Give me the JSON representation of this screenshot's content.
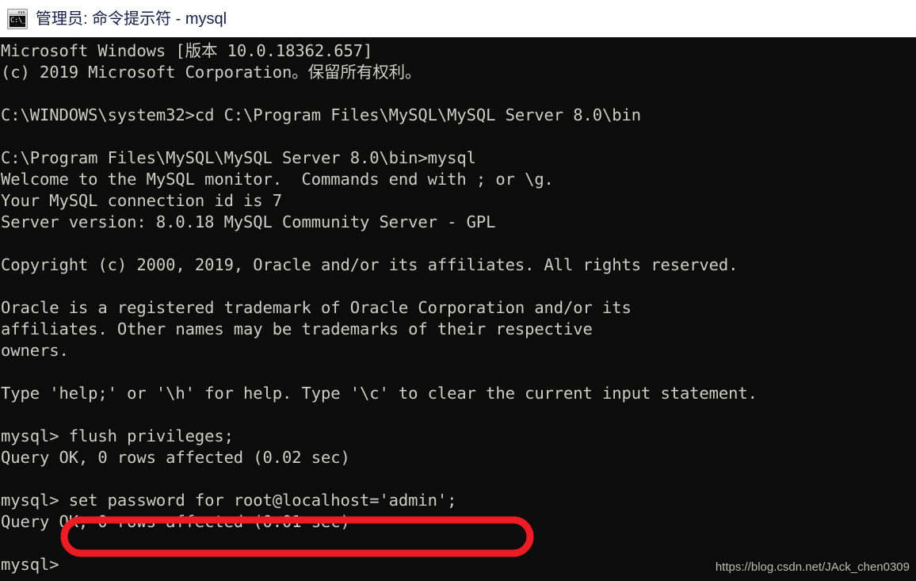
{
  "window": {
    "title": "管理员: 命令提示符 - mysql",
    "icon": "cmd-icon",
    "icon_glyph": "C:\\_",
    "background_color": "#0c0c0c",
    "text_color": "#ccccc8",
    "titlebar_color": "#ffffff"
  },
  "console": {
    "text": "Microsoft Windows [版本 10.0.18362.657]\n(c) 2019 Microsoft Corporation。保留所有权利。\n\nC:\\WINDOWS\\system32>cd C:\\Program Files\\MySQL\\MySQL Server 8.0\\bin\n\nC:\\Program Files\\MySQL\\MySQL Server 8.0\\bin>mysql\nWelcome to the MySQL monitor.  Commands end with ; or \\g.\nYour MySQL connection id is 7\nServer version: 8.0.18 MySQL Community Server - GPL\n\nCopyright (c) 2000, 2019, Oracle and/or its affiliates. All rights reserved.\n\nOracle is a registered trademark of Oracle Corporation and/or its\naffiliates. Other names may be trademarks of their respective\nowners.\n\nType 'help;' or '\\h' for help. Type '\\c' to clear the current input statement.\n\nmysql> flush privileges;\nQuery OK, 0 rows affected (0.02 sec)\n\nmysql> set password for root@localhost='admin';\nQuery OK, 0 rows affected (0.01 sec)\n\nmysql>",
    "lines": [
      "Microsoft Windows [版本 10.0.18362.657]",
      "(c) 2019 Microsoft Corporation。保留所有权利。",
      "",
      "C:\\WINDOWS\\system32>cd C:\\Program Files\\MySQL\\MySQL Server 8.0\\bin",
      "",
      "C:\\Program Files\\MySQL\\MySQL Server 8.0\\bin>mysql",
      "Welcome to the MySQL monitor.  Commands end with ; or \\g.",
      "Your MySQL connection id is 7",
      "Server version: 8.0.18 MySQL Community Server - GPL",
      "",
      "Copyright (c) 2000, 2019, Oracle and/or its affiliates. All rights reserved.",
      "",
      "Oracle is a registered trademark of Oracle Corporation and/or its",
      "affiliates. Other names may be trademarks of their respective",
      "owners.",
      "",
      "Type 'help;' or '\\h' for help. Type '\\c' to clear the current input statement.",
      "",
      "mysql> flush privileges;",
      "Query OK, 0 rows affected (0.02 sec)",
      "",
      "mysql> set password for root@localhost='admin';",
      "Query OK, 0 rows affected (0.01 sec)",
      "",
      "mysql>"
    ],
    "prompt": "mysql>",
    "commands": [
      "cd C:\\Program Files\\MySQL\\MySQL Server 8.0\\bin",
      "mysql",
      "flush privileges;",
      "set password for root@localhost='admin';"
    ],
    "results": [
      "Query OK, 0 rows affected (0.02 sec)",
      "Query OK, 0 rows affected (0.01 sec)"
    ]
  },
  "annotation": {
    "shape": "rounded-rectangle",
    "color": "#ed1c24",
    "highlighted_text": "set password for root@localhost='admin';"
  },
  "watermark": {
    "text": "https://blog.csdn.net/JAck_chen0309"
  }
}
